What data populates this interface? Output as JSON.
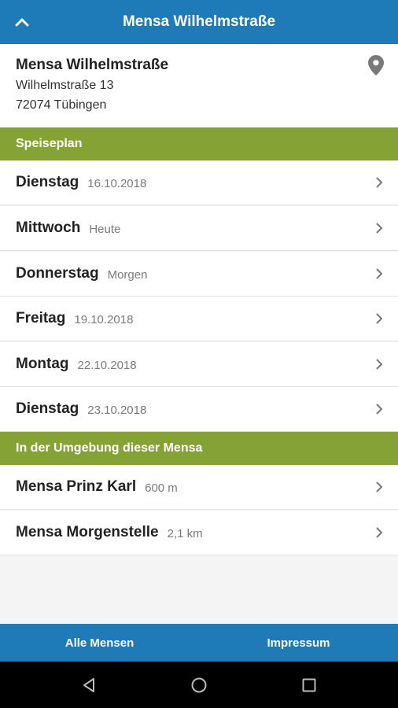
{
  "header": {
    "title": "Mensa Wilhelmstraße",
    "back_icon": "chevron-up-icon"
  },
  "mensa": {
    "name": "Mensa Wilhelmstraße",
    "street": "Wilhelmstraße 13",
    "city": "72074 Tübingen",
    "location_icon": "location-pin-icon"
  },
  "speiseplan": {
    "title": "Speiseplan",
    "days": [
      {
        "day": "Dienstag",
        "detail": "16.10.2018"
      },
      {
        "day": "Mittwoch",
        "detail": "Heute"
      },
      {
        "day": "Donnerstag",
        "detail": "Morgen"
      },
      {
        "day": "Freitag",
        "detail": "19.10.2018"
      },
      {
        "day": "Montag",
        "detail": "22.10.2018"
      },
      {
        "day": "Dienstag",
        "detail": "23.10.2018"
      }
    ]
  },
  "nearby": {
    "title": "In der Umgebung dieser Mensa",
    "items": [
      {
        "name": "Mensa Prinz Karl",
        "distance": "600 m"
      },
      {
        "name": "Mensa Morgenstelle",
        "distance": "2,1 km"
      }
    ]
  },
  "footer": {
    "all_label": "Alle Mensen",
    "impressum_label": "Impressum"
  },
  "colors": {
    "primary": "#1f7ab8",
    "section": "#85a335"
  }
}
